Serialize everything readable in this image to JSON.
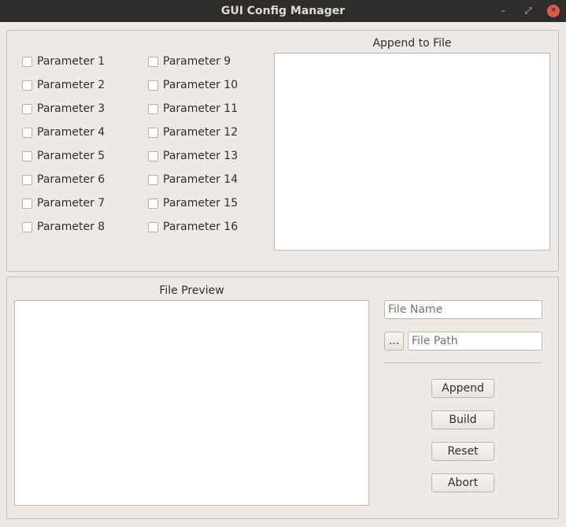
{
  "window": {
    "title": "GUI Config Manager",
    "controls": {
      "minimize": "–",
      "maximize": "⤢",
      "close": "✕"
    }
  },
  "parameters": {
    "left": [
      "Parameter 1",
      "Parameter 2",
      "Parameter 3",
      "Parameter 4",
      "Parameter 5",
      "Parameter 6",
      "Parameter 7",
      "Parameter 8"
    ],
    "right": [
      "Parameter 9",
      "Parameter 10",
      "Parameter 11",
      "Parameter 12",
      "Parameter 13",
      "Parameter 14",
      "Parameter 15",
      "Parameter 16"
    ]
  },
  "append_section": {
    "label": "Append to File",
    "content": ""
  },
  "preview_section": {
    "label": "File Preview",
    "content": ""
  },
  "file_name": {
    "value": "",
    "placeholder": "File Name"
  },
  "file_path": {
    "value": "",
    "placeholder": "File Path"
  },
  "buttons": {
    "browse": "...",
    "append": "Append",
    "build": "Build",
    "reset": "Reset",
    "abort": "Abort"
  },
  "colors": {
    "titlebar": "#2e2d2b",
    "background": "#edeae5",
    "close_button": "#e15a4e"
  }
}
